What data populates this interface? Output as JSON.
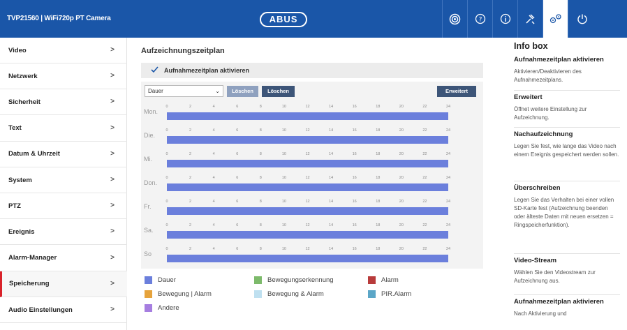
{
  "header": {
    "app_title": "TVP21560 | WiFi720p PT Camera",
    "logo_text": "ABUS",
    "buttons": [
      "live-view-icon",
      "help-icon",
      "info-icon",
      "wrench-icon",
      "settings-icon",
      "power-icon"
    ],
    "accent": "#1a56a8"
  },
  "sidebar": {
    "items": [
      {
        "label": "Video"
      },
      {
        "label": "Netzwerk"
      },
      {
        "label": "Sicherheit"
      },
      {
        "label": "Text"
      },
      {
        "label": "Datum & Uhrzeit"
      },
      {
        "label": "System"
      },
      {
        "label": "PTZ"
      },
      {
        "label": "Ereignis"
      },
      {
        "label": "Alarm-Manager"
      },
      {
        "label": "Speicherung",
        "active": true
      },
      {
        "label": "Audio Einstellungen"
      }
    ],
    "chevron": ">"
  },
  "main": {
    "title": "Aufzeichnungszeitplan",
    "enable_label": "Aufnahmezeitplan aktivieren",
    "enable_checked": true,
    "select_value": "Dauer",
    "btn_loeschen_1": "Löschen",
    "btn_loeschen_2": "Löschen",
    "btn_erweitert": "Erweitert",
    "hours": [
      "0",
      "2",
      "4",
      "6",
      "8",
      "10",
      "12",
      "14",
      "16",
      "18",
      "20",
      "22",
      "24"
    ],
    "days": [
      "Mon.",
      "Die.",
      "Mi.",
      "Don.",
      "Fr.",
      "Sa.",
      "So"
    ],
    "bar_color": "#6b7fdc"
  },
  "legend": [
    {
      "label": "Dauer",
      "color": "#6b7fdc"
    },
    {
      "label": "Bewegungserkennung",
      "color": "#7dba6b"
    },
    {
      "label": "Alarm",
      "color": "#b83b3b"
    },
    {
      "label": "Bewegung | Alarm",
      "color": "#e6a33c"
    },
    {
      "label": "Bewegung & Alarm",
      "color": "#bfe0f0"
    },
    {
      "label": "PIR.Alarm",
      "color": "#5ba6c7"
    },
    {
      "label": "Andere",
      "color": "#a67ee0"
    }
  ],
  "infobox": {
    "title": "Info box",
    "sections": [
      {
        "heading": "Aufnahmezeitplan aktivieren",
        "text": "Aktivieren/Deaktivieren des Aufnahmezeitplans."
      },
      {
        "heading": "Erweitert",
        "text": "Öffnet weitere Einstellung zur Aufzeichnung."
      },
      {
        "heading": "Nachaufzeichnung",
        "text": "Legen Sie fest, wie lange das Video nach einem Ereignis gespeichert werden sollen."
      },
      {
        "heading": "Überschreiben",
        "text": "Legen Sie das Verhalten bei einer vollen SD-Karte fest (Aufzeichnung beenden oder älteste Daten mit neuen ersetzen = Ringspeicherfunktion)."
      },
      {
        "heading": "Video-Stream",
        "text": "Wählen Sie den Videostream zur Aufzeichnung aus."
      },
      {
        "heading": "Aufnahmezeitplan aktivieren",
        "text": "Nach Aktivierung und"
      }
    ]
  }
}
